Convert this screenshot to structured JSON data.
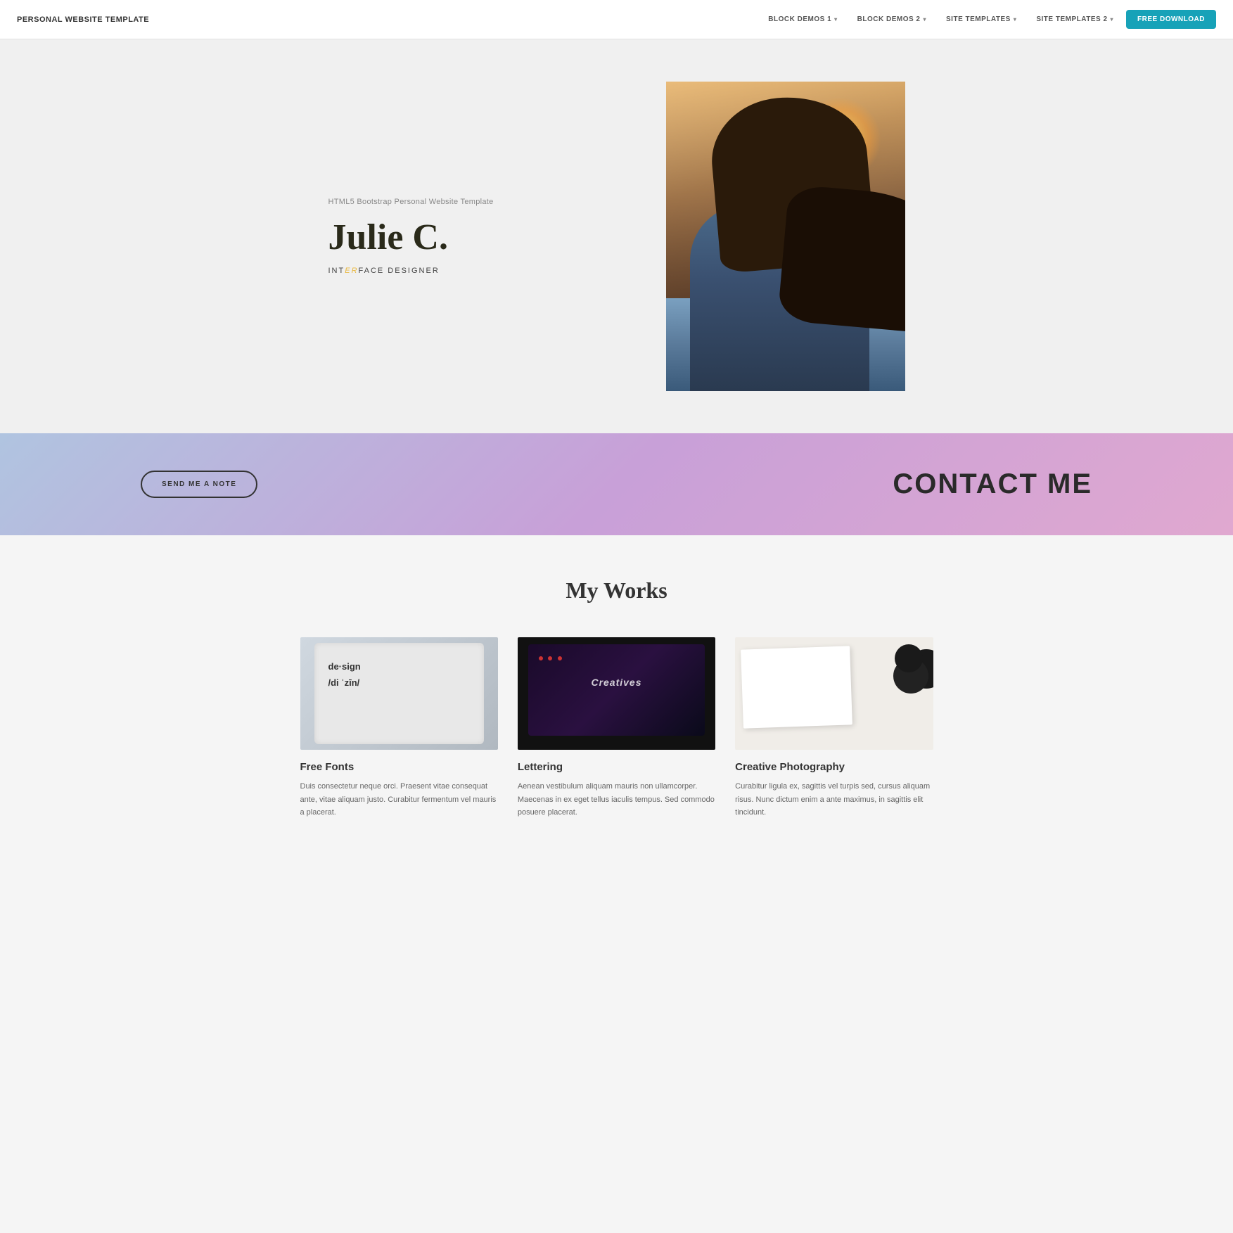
{
  "navbar": {
    "brand": "PERSONAL WEBSITE TEMPLATE",
    "links": [
      {
        "label": "BLOCK DEMOS 1",
        "hasDropdown": true
      },
      {
        "label": "BLOCK DEMOS 2",
        "hasDropdown": true
      },
      {
        "label": "SITE TEMPLATES",
        "hasDropdown": true
      },
      {
        "label": "SITE TEMPLATES 2",
        "hasDropdown": true
      }
    ],
    "download_label": "FREE DOWNLOAD"
  },
  "hero": {
    "subtitle": "HTML5 Bootstrap Personal Website Template",
    "name": "Julie C.",
    "role_prefix": "INT",
    "role_highlight": "ER",
    "role_suffix": "FACE DESIGNER"
  },
  "contact": {
    "button_label": "SEND ME A NOTE",
    "title": "CONTACT ME"
  },
  "works": {
    "section_title": "My Works",
    "items": [
      {
        "title": "Free Fonts",
        "description": "Duis consectetur neque orci. Praesent vitae consequat ante, vitae aliquam justo. Curabitur fermentum vel mauris a placerat."
      },
      {
        "title": "Lettering",
        "description": "Aenean vestibulum aliquam mauris non ullamcorper. Maecenas in ex eget tellus iaculis tempus. Sed commodo posuere placerat."
      },
      {
        "title": "Creative Photography",
        "description": "Curabitur ligula ex, sagittis vel turpis sed, cursus aliquam risus. Nunc dictum enim a ante maximus, in sagittis elit tincidunt."
      }
    ]
  }
}
